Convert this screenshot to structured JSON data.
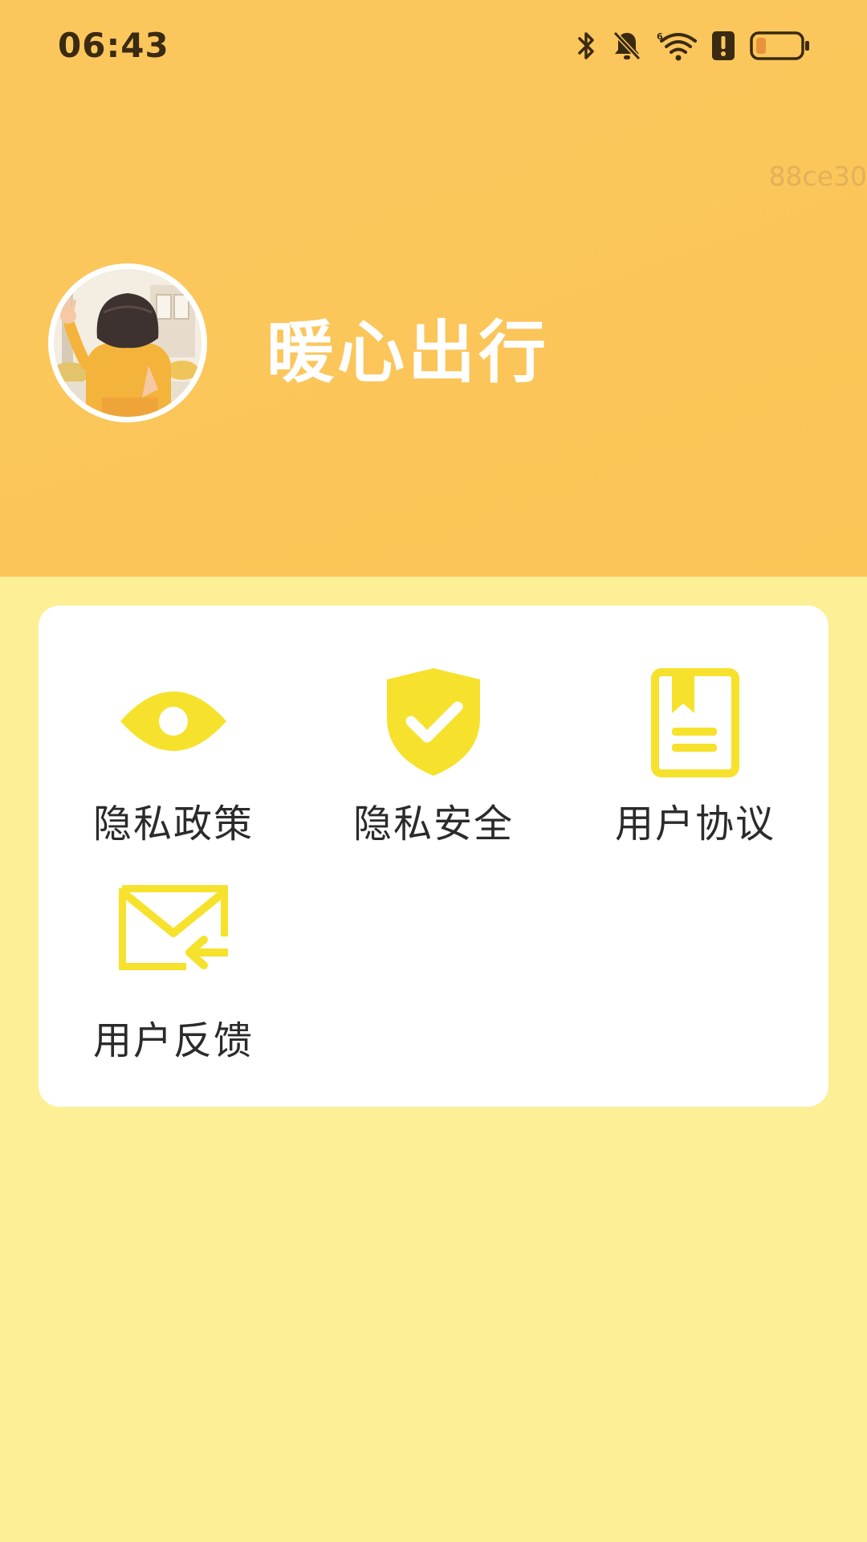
{
  "status_bar": {
    "time": "06:43",
    "icons": [
      "bluetooth-icon",
      "bell-off-icon",
      "wifi-icon",
      "alert-icon",
      "battery-low-icon"
    ]
  },
  "debug_id": "88ce30",
  "header": {
    "app_name": "暖心出行",
    "avatar": "girl-waving-illustration"
  },
  "colors": {
    "header_bg": "#FBC75D",
    "page_bg": "#FDEF96",
    "icon_yellow": "#F6E22C",
    "text_dark": "#2B2B2B"
  },
  "menu": {
    "items": [
      {
        "label": "隐私政策",
        "icon": "eye-icon"
      },
      {
        "label": "隐私安全",
        "icon": "shield-check-icon"
      },
      {
        "label": "用户协议",
        "icon": "bookmark-book-icon"
      },
      {
        "label": "用户反馈",
        "icon": "mail-reply-icon"
      }
    ]
  }
}
